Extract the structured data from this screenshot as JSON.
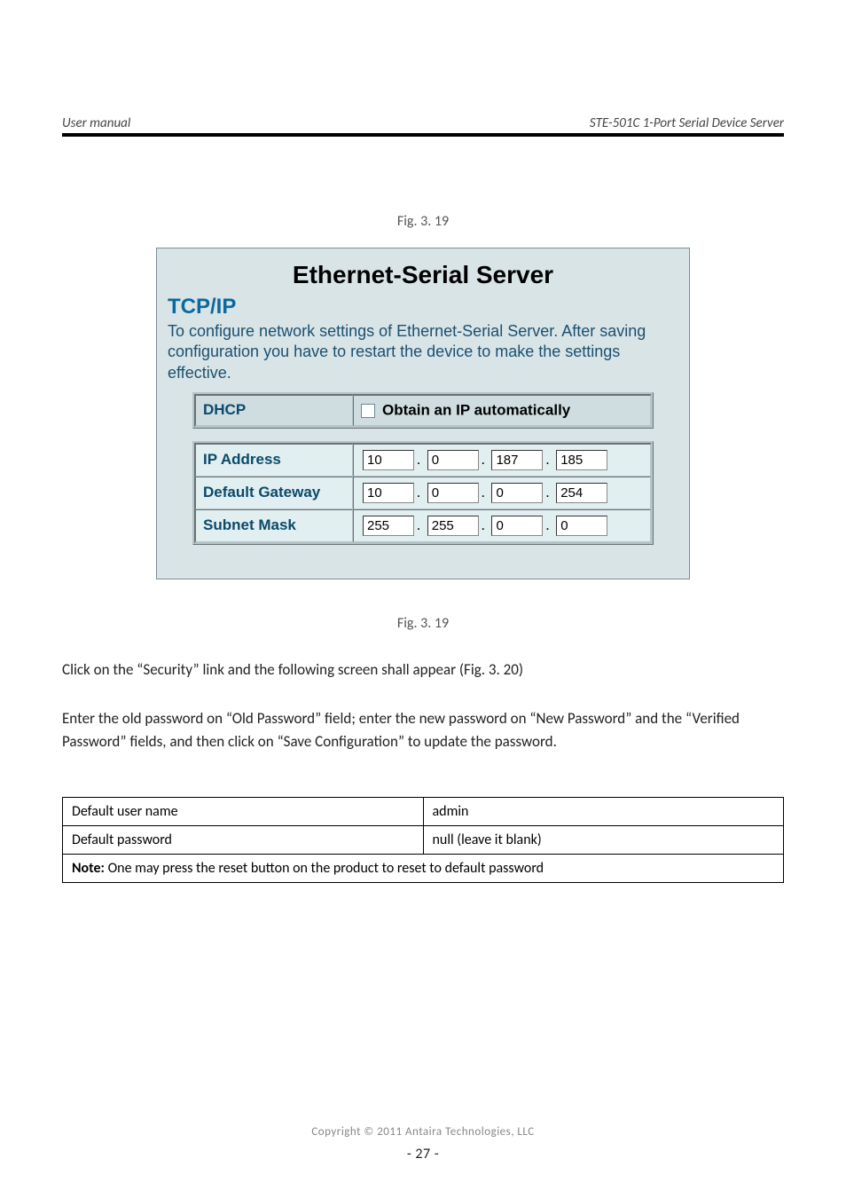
{
  "header": {
    "left": "User manual",
    "right": "STE-501C 1-Port Serial Device Server"
  },
  "captions": {
    "fig19a": "Fig. 3. 19",
    "fig19b": "Fig. 3. 19"
  },
  "screenshot": {
    "title": "Ethernet-Serial Server",
    "section": "TCP/IP",
    "description": "To configure network settings of Ethernet-Serial Server. After saving configuration you have to restart the device to make the settings effective.",
    "dhcp_label": "DHCP",
    "obtain_label": "Obtain an IP automatically",
    "dhcp_checked": false,
    "rows": [
      {
        "label": "IP Address",
        "octets": [
          "10",
          "0",
          "187",
          "185"
        ]
      },
      {
        "label": "Default Gateway",
        "octets": [
          "10",
          "0",
          "0",
          "254"
        ]
      },
      {
        "label": "Subnet Mask",
        "octets": [
          "255",
          "255",
          "0",
          "0"
        ]
      }
    ]
  },
  "body": {
    "line1": "Click on the",
    "quoted": "“Security”",
    "line1b": "link and the following screen shall appear (",
    "figref": "Fig. 3. 20",
    "line1c": ")",
    "line2": "Enter the old password on",
    "quoted2": "“Old Password”",
    "line2b": "field; enter the new password on",
    "quoted3": "“New Password”",
    "line2c": "and the",
    "line3": "",
    "quoted4": "“Verified Password”",
    "line3b": "fields, and then click on",
    "quoted5": "“Save Configuration”",
    "line3c": "to update the password."
  },
  "admin_table": {
    "r1c1": "Default user name",
    "r1c2": "admin",
    "r2c1": "Default password",
    "r2c2": "null (leave it blank)",
    "note": "Note:",
    "note_text": " One may press the reset button on the product to reset to default password"
  },
  "footer": {
    "copyright": "Copyright © 2011 Antaira Technologies, LLC",
    "page": "- 27 -"
  }
}
